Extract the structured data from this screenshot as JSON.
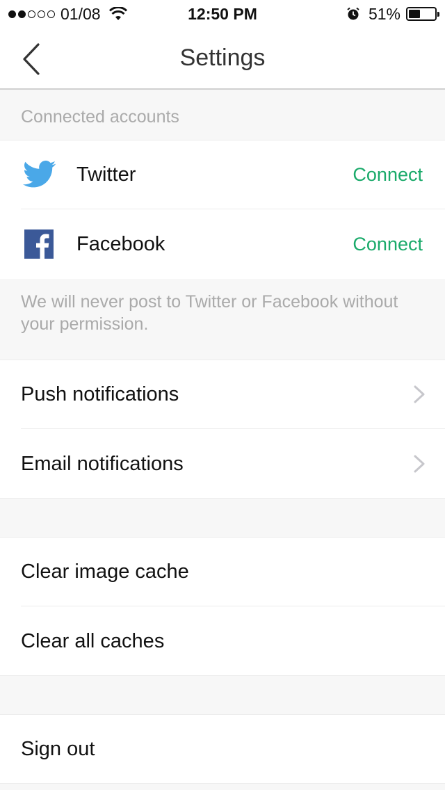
{
  "status_bar": {
    "carrier": "01/08",
    "time": "12:50 PM",
    "battery": "51%",
    "battery_level": 0.51
  },
  "nav": {
    "title": "Settings"
  },
  "connected_accounts": {
    "header": "Connected accounts",
    "accounts": [
      {
        "name": "Twitter",
        "action": "Connect",
        "icon": "twitter-icon"
      },
      {
        "name": "Facebook",
        "action": "Connect",
        "icon": "facebook-icon"
      }
    ],
    "note": "We will never post to Twitter or Facebook without your permission."
  },
  "notifications": {
    "items": [
      {
        "label": "Push notifications"
      },
      {
        "label": "Email notifications"
      }
    ]
  },
  "cache": {
    "items": [
      {
        "label": "Clear image cache"
      },
      {
        "label": "Clear all caches"
      }
    ]
  },
  "account": {
    "sign_out": "Sign out"
  },
  "colors": {
    "accent_green": "#1aaa6a",
    "twitter_blue": "#4aa8e8",
    "facebook_blue": "#3b5998"
  }
}
